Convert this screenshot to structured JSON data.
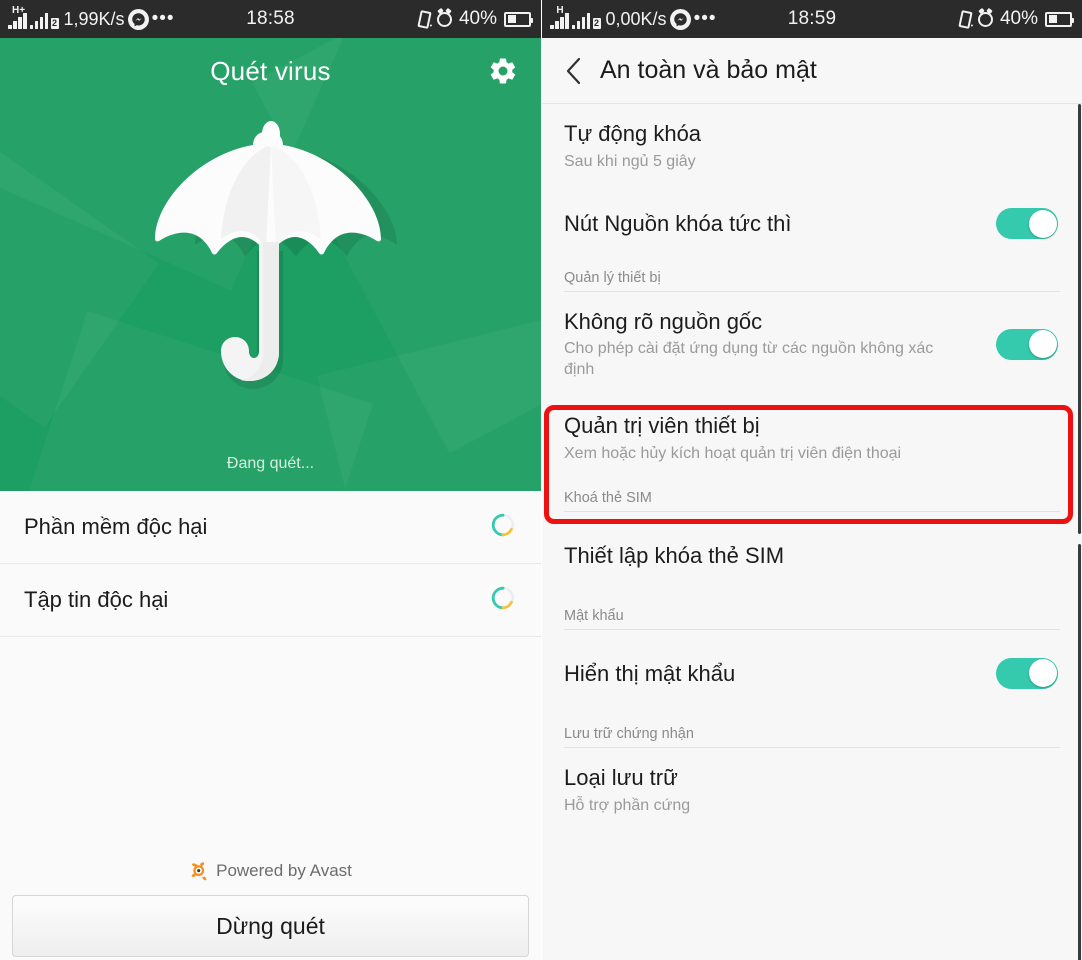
{
  "left_phone": {
    "statusbar": {
      "network_type": "H+",
      "sim_badge": "2",
      "speed": "1,99K/s",
      "messenger_icon": "messenger-icon",
      "overflow_dots": "•••",
      "time": "18:58",
      "vibrate_icon": "vibrate-icon",
      "alarm_icon": "alarm-icon",
      "battery_percent": "40%",
      "battery_icon": "battery-icon"
    },
    "app": {
      "title": "Quét virus",
      "settings_icon": "gear-icon",
      "hero_icon": "umbrella-icon",
      "hero_bg_color": "#1d9e62",
      "scan_status": "Đang quét...",
      "rows": [
        {
          "label": "Phần mềm độc hại",
          "indicator": "loading-spinner"
        },
        {
          "label": "Tập tin độc hại",
          "indicator": "loading-spinner"
        }
      ],
      "powered_by": "Powered by Avast",
      "powered_by_icon": "avast-logo-icon",
      "stop_button": "Dừng quét"
    }
  },
  "right_phone": {
    "statusbar": {
      "network_type": "H",
      "sim_badge": "2",
      "speed": "0,00K/s",
      "messenger_icon": "messenger-icon",
      "overflow_dots": "•••",
      "time": "18:59",
      "vibrate_icon": "vibrate-icon",
      "alarm_icon": "alarm-icon",
      "battery_percent": "40%",
      "battery_icon": "battery-icon"
    },
    "settings": {
      "back_icon": "back-chevron-icon",
      "title": "An toàn và bảo mật",
      "items": [
        {
          "kind": "row",
          "title": "Tự động khóa",
          "subtitle": "Sau khi ngủ 5 giây",
          "toggle": null
        },
        {
          "kind": "row",
          "title": "Nút Nguồn khóa tức thì",
          "subtitle": "",
          "toggle": "on"
        },
        {
          "kind": "section",
          "title": "Quản lý thiết bị"
        },
        {
          "kind": "row",
          "title": "Không rõ nguồn gốc",
          "subtitle": "Cho phép cài đặt ứng dụng từ các nguồn không xác định",
          "toggle": "on",
          "highlighted": true
        },
        {
          "kind": "row",
          "title": "Quản trị viên thiết bị",
          "subtitle": "Xem hoặc hủy kích hoạt quản trị viên điện thoại",
          "toggle": null
        },
        {
          "kind": "section",
          "title": "Khoá thẻ SIM"
        },
        {
          "kind": "row",
          "title": "Thiết lập khóa thẻ SIM",
          "subtitle": "",
          "toggle": null
        },
        {
          "kind": "section",
          "title": "Mật khẩu"
        },
        {
          "kind": "row",
          "title": "Hiển thị mật khẩu",
          "subtitle": "",
          "toggle": "on"
        },
        {
          "kind": "section",
          "title": "Lưu trữ chứng nhận"
        },
        {
          "kind": "row",
          "title": "Loại lưu trữ",
          "subtitle": "Hỗ trợ phần cứng",
          "toggle": null
        }
      ],
      "highlight_color": "#ee1111",
      "toggle_on_color": "#35c9ae"
    }
  }
}
